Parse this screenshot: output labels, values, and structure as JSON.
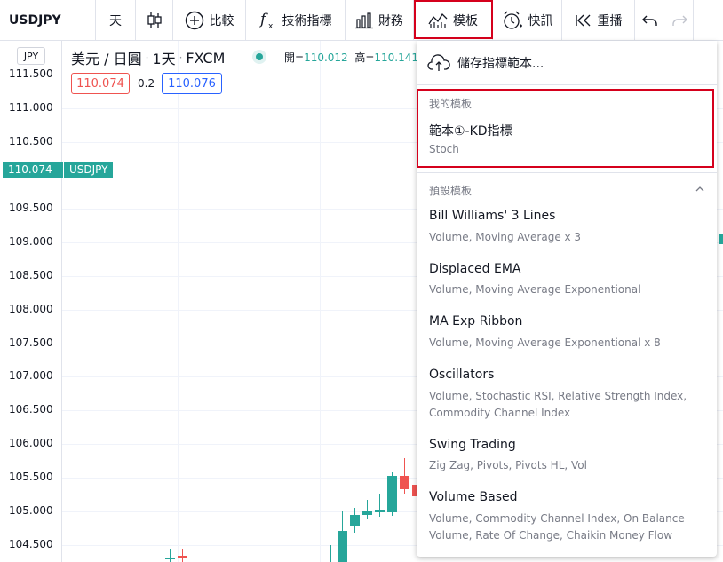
{
  "toolbar": {
    "symbol": "USDJPY",
    "interval": "天",
    "compare_label": "比較",
    "indicators_label": "技術指標",
    "financials_label": "財務",
    "templates_label": "模板",
    "alert_label": "快訊",
    "replay_label": "重播"
  },
  "legend": {
    "currency_box": "JPY",
    "title": "美元 / 日圓",
    "interval": "1天",
    "exchange": "FXCM",
    "open_label": "開=",
    "open_value": "110.012",
    "high_label": "高=",
    "high_value": "110.141",
    "bid": "110.074",
    "spread": "0.2",
    "ask": "110.076"
  },
  "yaxis": {
    "labels": [
      "111.500",
      "111.000",
      "110.500",
      "110.000",
      "109.500",
      "109.000",
      "108.500",
      "108.000",
      "107.500",
      "107.000",
      "106.500",
      "106.000",
      "105.500",
      "105.000",
      "104.500"
    ],
    "current_price": "110.074",
    "current_symbol": "USDJPY"
  },
  "colors": {
    "up": "#26a69a",
    "down": "#ef5350",
    "highlight": "#d5001c",
    "accent_blue": "#2962ff"
  },
  "dropdown": {
    "save_label": "儲存指標範本...",
    "my_templates_heading": "我的模板",
    "my_templates": [
      {
        "name": "範本①-KD指標",
        "desc": "Stoch"
      }
    ],
    "default_templates_heading": "預設模板",
    "default_templates": [
      {
        "name": "Bill Williams' 3 Lines",
        "desc": "Volume, Moving Average x 3"
      },
      {
        "name": "Displaced EMA",
        "desc": "Volume, Moving Average Exponentional"
      },
      {
        "name": "MA Exp Ribbon",
        "desc": "Volume, Moving Average Exponentional x 8"
      },
      {
        "name": "Oscillators",
        "desc": "Volume, Stochastic RSI, Relative Strength Index, Commodity Channel Index"
      },
      {
        "name": "Swing Trading",
        "desc": "Zig Zag, Pivots, Pivots HL, Vol"
      },
      {
        "name": "Volume Based",
        "desc": "Volume, Commodity Channel Index, On Balance Volume, Rate Of Change, Chaikin Money Flow"
      }
    ]
  }
}
